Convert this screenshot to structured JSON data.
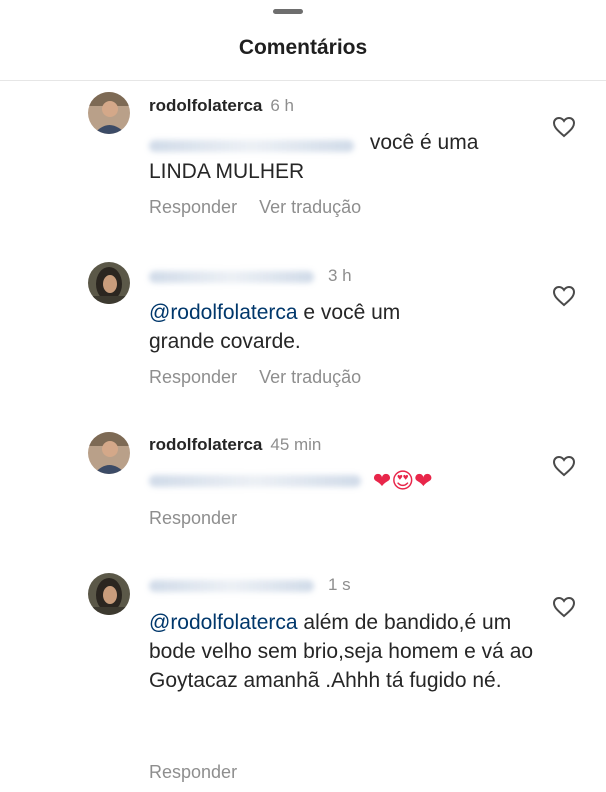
{
  "header": {
    "title": "Comentários"
  },
  "comments": [
    {
      "username": "rodolfolaterca",
      "time": "6 h",
      "text_suffix": "você é uma",
      "text_line2": "LINDA MULHER",
      "reply_label": "Responder",
      "translate_label": "Ver tradução"
    },
    {
      "time": "3 h",
      "mention": "@rodolfolaterca",
      "text": " e você um grande covarde.",
      "reply_label": "Responder",
      "translate_label": "Ver tradução"
    },
    {
      "username": "rodolfolaterca",
      "time": "45 min",
      "emojis": "❤😍❤",
      "reply_label": "Responder"
    },
    {
      "time": "1 s",
      "mention": "@rodolfolaterca",
      "text": " além de bandido,é um bode velho sem brio,seja homem e vá ao Goytacaz amanhã .Ahhh tá fugido né.",
      "reply_label": "Responder"
    }
  ]
}
